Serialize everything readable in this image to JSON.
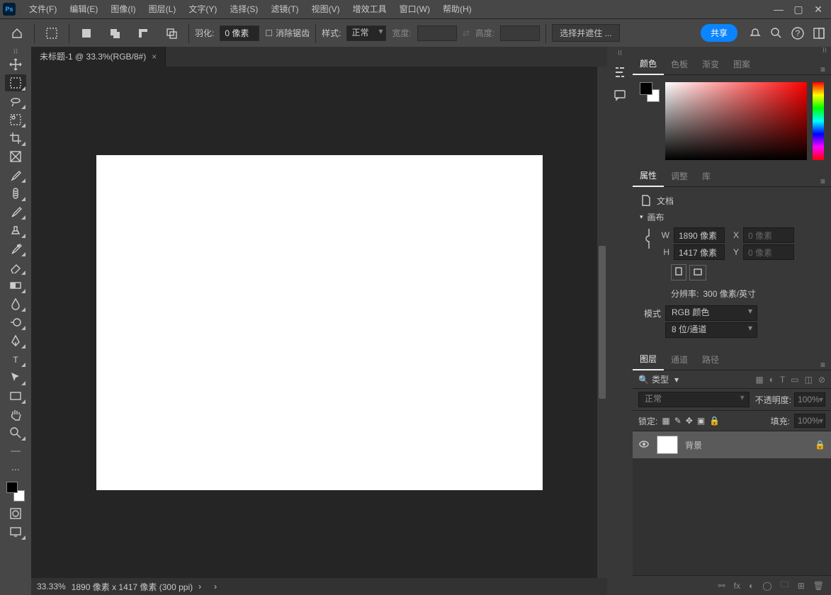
{
  "app": {
    "logo": "Ps"
  },
  "menu": {
    "file": "文件(F)",
    "edit": "编辑(E)",
    "image": "图像(I)",
    "layer": "图层(L)",
    "type": "文字(Y)",
    "select": "选择(S)",
    "filter": "滤镜(T)",
    "view": "视图(V)",
    "plugin": "增效工具",
    "window": "窗口(W)",
    "help": "帮助(H)"
  },
  "options": {
    "feather_label": "羽化:",
    "feather_value": "0 像素",
    "antialias": "消除锯齿",
    "style_label": "样式:",
    "style_value": "正常",
    "width_label": "宽度:",
    "height_label": "高度:",
    "mask_btn": "选择并遮住",
    "share": "共享"
  },
  "doc": {
    "tab": "未标题-1 @ 33.3%(RGB/8#)"
  },
  "status": {
    "zoom": "33.33%",
    "info": "1890 像素 x 1417 像素 (300 ppi)"
  },
  "panels": {
    "color_tabs": {
      "color": "颜色",
      "swatch": "色板",
      "gradient": "渐变",
      "pattern": "图案"
    },
    "prop_tabs": {
      "prop": "属性",
      "adjust": "调整",
      "lib": "库"
    },
    "prop": {
      "doc": "文档",
      "canvas": "画布",
      "w_label": "W",
      "w_value": "1890 像素",
      "x_label": "X",
      "x_value": "0 像素",
      "h_label": "H",
      "h_value": "1417 像素",
      "y_label": "Y",
      "y_value": "0 像素",
      "res_label": "分辨率:",
      "res_value": "300 像素/英寸",
      "mode_label": "模式",
      "mode_value": "RGB 颜色",
      "depth_value": "8 位/通道"
    },
    "layer_tabs": {
      "layers": "图层",
      "channels": "通道",
      "paths": "路径"
    },
    "layers": {
      "filter": "类型",
      "blend": "正常",
      "opacity_label": "不透明度:",
      "opacity_value": "100%",
      "lock_label": "锁定:",
      "fill_label": "填充:",
      "fill_value": "100%",
      "bg_name": "背景"
    }
  }
}
